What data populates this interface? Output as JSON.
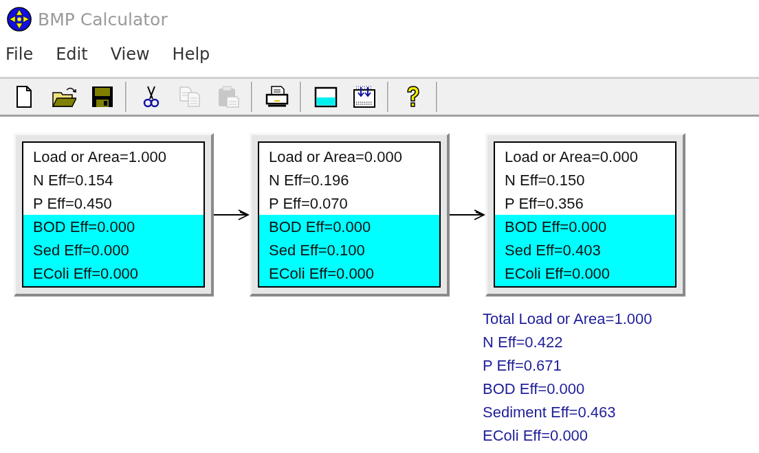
{
  "window": {
    "title": "BMP Calculator"
  },
  "menu": [
    {
      "label": "File"
    },
    {
      "label": "Edit"
    },
    {
      "label": "View"
    },
    {
      "label": "Help"
    }
  ],
  "toolbar": [
    [
      {
        "disabled": false
      },
      {
        "disabled": false
      },
      {
        "disabled": false
      }
    ],
    [
      {
        "disabled": false
      },
      {
        "disabled": true
      },
      {
        "disabled": true
      }
    ],
    [
      {
        "disabled": false
      }
    ],
    [
      {
        "disabled": false
      },
      {
        "disabled": false
      }
    ],
    [
      {
        "disabled": false
      }
    ]
  ],
  "bmps": [
    {
      "lines": [
        "Load or Area=1.000",
        "N Eff=0.154",
        "P Eff=0.450",
        "BOD Eff=0.000",
        "Sed Eff=0.000",
        "EColi Eff=0.000"
      ]
    },
    {
      "lines": [
        "Load or Area=0.000",
        "N Eff=0.196",
        "P Eff=0.070",
        "BOD Eff=0.000",
        "Sed Eff=0.100",
        "EColi Eff=0.000"
      ]
    },
    {
      "lines": [
        "Load or Area=0.000",
        "N Eff=0.150",
        "P Eff=0.356",
        "BOD Eff=0.000",
        "Sed Eff=0.403",
        "EColi Eff=0.000"
      ]
    }
  ],
  "totals": [
    "Total Load or Area=1.000",
    "N Eff=0.422",
    "P Eff=0.671",
    "BOD Eff=0.000",
    "Sediment Eff=0.463",
    "EColi Eff=0.000"
  ]
}
